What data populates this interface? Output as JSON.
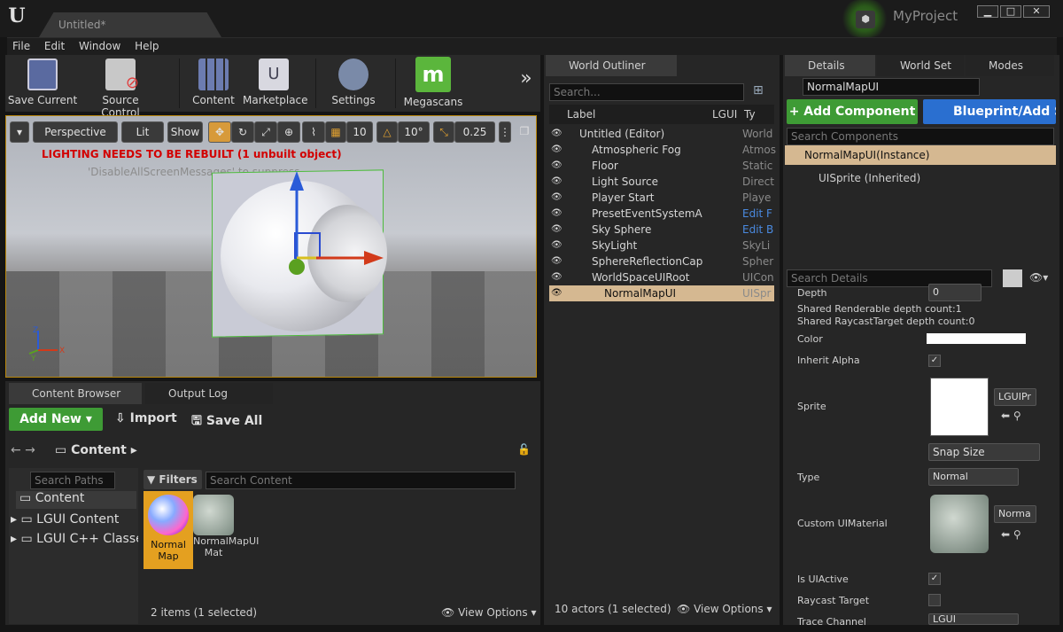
{
  "window": {
    "tab": "Untitled*",
    "project": "MyProject",
    "min": "▁",
    "max": "□",
    "close": "✕"
  },
  "menu": [
    "File",
    "Edit",
    "Window",
    "Help"
  ],
  "toolbar": {
    "save": "Save Current",
    "source": "Source Control",
    "content": "Content",
    "marketplace": "Marketplace",
    "settings": "Settings",
    "megascans": "Megascans",
    "more": "»"
  },
  "viewport": {
    "perspective": "Perspective",
    "lit": "Lit",
    "show": "Show",
    "grid": "10",
    "angle": "10°",
    "scale": "0.25",
    "warning": "LIGHTING NEEDS TO BE REBUILT (1 unbuilt object)",
    "suppress": "'DisableAllScreenMessages' to suppress"
  },
  "content_browser": {
    "tab": "Content Browser",
    "output_tab": "Output Log",
    "add_new": "Add New",
    "import": "Import",
    "save_all": "Save All",
    "breadcrumb": "Content",
    "search_paths": "Search Paths",
    "filters": "Filters",
    "search_content": "Search Content",
    "tree": [
      "Content",
      "LGUI Content",
      "LGUI C++ Classes"
    ],
    "assets": [
      {
        "name": "Normal Map"
      },
      {
        "name": "NormalMapUI Mat"
      }
    ],
    "status": "2 items (1 selected)",
    "view_options": "View Options"
  },
  "outliner": {
    "tab": "World Outliner",
    "search": "Search...",
    "col_label": "Label",
    "col_lgui": "LGUI",
    "col_type": "Ty",
    "rows": [
      {
        "label": "Untitled (Editor)",
        "type": "World",
        "indent": 0
      },
      {
        "label": "Atmospheric Fog",
        "type": "Atmos",
        "indent": 1
      },
      {
        "label": "Floor",
        "type": "Static",
        "indent": 1
      },
      {
        "label": "Light Source",
        "type": "Direct",
        "indent": 1
      },
      {
        "label": "Player Start",
        "type": "Playe",
        "indent": 1
      },
      {
        "label": "PresetEventSystemA",
        "type": "Edit F",
        "indent": 1
      },
      {
        "label": "Sky Sphere",
        "type": "Edit B",
        "indent": 1
      },
      {
        "label": "SkyLight",
        "type": "SkyLi",
        "indent": 1
      },
      {
        "label": "SphereReflectionCap",
        "type": "Spher",
        "indent": 1
      },
      {
        "label": "WorldSpaceUIRoot",
        "type": "UICon",
        "indent": 1
      },
      {
        "label": "NormalMapUI",
        "type": "UISpr",
        "indent": 2
      }
    ],
    "status": "10 actors (1 selected)",
    "view_options": "View Options"
  },
  "details": {
    "tab": "Details",
    "world_tab": "World Set",
    "modes_tab": "Modes",
    "name": "NormalMapUI",
    "add_component": "+ Add Component",
    "blueprint": "Blueprint/Add S",
    "search_components": "Search Components",
    "instance": "NormalMapUI(Instance)",
    "inherited": "UISprite (Inherited)",
    "search_details": "Search Details",
    "depth_label": "Depth",
    "depth_value": "0",
    "shared_render": "Shared Renderable depth count:1",
    "shared_raycast": "Shared RaycastTarget depth count:0",
    "color": "Color",
    "inherit_alpha": "Inherit Alpha",
    "sprite": "Sprite",
    "sprite_dd": "LGUIPr",
    "snap": "Snap Size",
    "type": "Type",
    "type_value": "Normal",
    "custom_mat": "Custom UIMaterial",
    "mat_dd": "Norma",
    "is_active": "Is UIActive",
    "raycast": "Raycast Target",
    "trace": "Trace Channel",
    "trace_value": "LGUI"
  }
}
